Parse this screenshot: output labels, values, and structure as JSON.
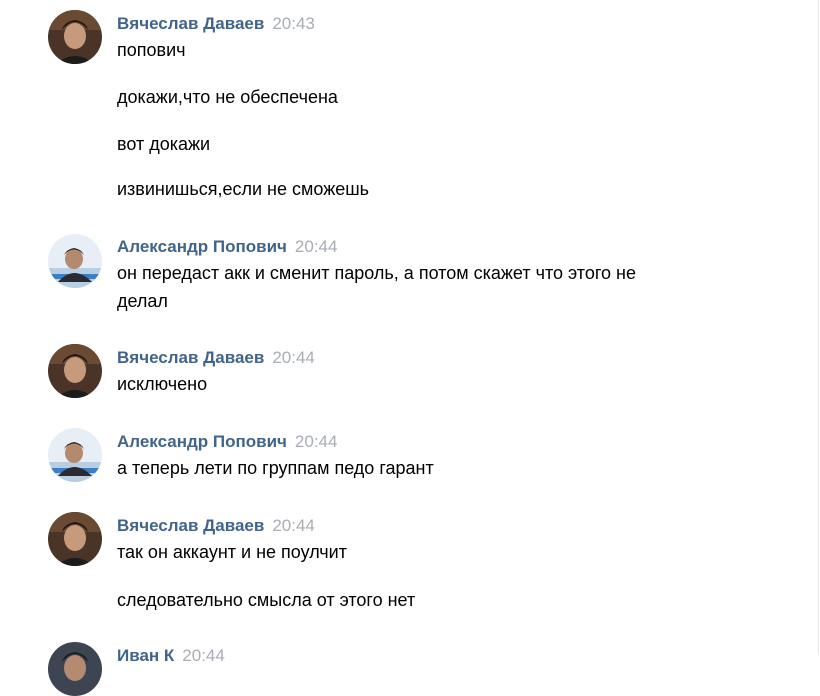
{
  "messages": [
    {
      "author": "Вячеслав Даваев",
      "time": "20:43",
      "lines": [
        "попович",
        "докажи,что не обеспечена",
        "вот докажи",
        "извинишься,если не сможешь"
      ]
    },
    {
      "author": "Александр Попович",
      "time": "20:44",
      "lines": [
        "он передаст акк и сменит пароль, а потом скажет что этого не",
        "делал"
      ]
    },
    {
      "author": "Вячеслав Даваев",
      "time": "20:44",
      "lines": [
        "исключено"
      ]
    },
    {
      "author": "Александр Попович",
      "time": "20:44",
      "lines": [
        "а теперь лети по группам педо гарант"
      ]
    },
    {
      "author": "Вячеслав Даваев",
      "time": "20:44",
      "lines": [
        "так он аккаунт и не поулчит",
        "следовательно смысла от этого нет"
      ]
    },
    {
      "author": "Иван К",
      "time": "20:44",
      "lines": []
    }
  ],
  "colors": {
    "author": "#42648b",
    "time": "#a8adb4",
    "text": "#000000"
  }
}
